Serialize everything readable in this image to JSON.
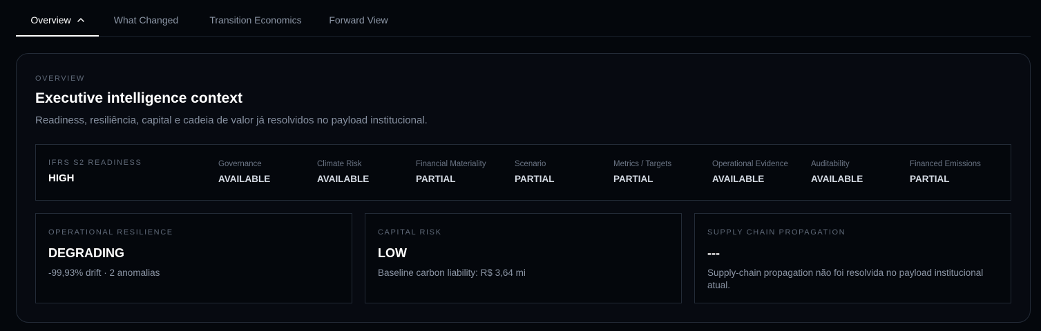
{
  "tabs": [
    {
      "label": "Overview",
      "active": true,
      "icon": "chevron-up-icon"
    },
    {
      "label": "What Changed",
      "active": false
    },
    {
      "label": "Transition Economics",
      "active": false
    },
    {
      "label": "Forward View",
      "active": false
    }
  ],
  "overview": {
    "eyebrow": "OVERVIEW",
    "title": "Executive intelligence context",
    "subtitle": "Readiness, resiliência, capital e cadeia de valor já resolvidos no payload institucional."
  },
  "readiness": {
    "label": "IFRS S2 READINESS",
    "value": "HIGH",
    "items": [
      {
        "label": "Governance",
        "value": "AVAILABLE"
      },
      {
        "label": "Climate Risk",
        "value": "AVAILABLE"
      },
      {
        "label": "Financial Materiality",
        "value": "PARTIAL"
      },
      {
        "label": "Scenario",
        "value": "PARTIAL"
      },
      {
        "label": "Metrics / Targets",
        "value": "PARTIAL"
      },
      {
        "label": "Operational Evidence",
        "value": "AVAILABLE"
      },
      {
        "label": "Auditability",
        "value": "AVAILABLE"
      },
      {
        "label": "Financed Emissions",
        "value": "PARTIAL"
      }
    ]
  },
  "cards": [
    {
      "label": "OPERATIONAL RESILIENCE",
      "value": "DEGRADING",
      "desc": "-99,93% drift · 2 anomalias"
    },
    {
      "label": "CAPITAL RISK",
      "value": "LOW",
      "desc": "Baseline carbon liability: R$ 3,64 mi"
    },
    {
      "label": "SUPPLY CHAIN PROPAGATION",
      "value": "---",
      "desc": "Supply-chain propagation não foi resolvida no payload institucional atual."
    }
  ],
  "colors": {
    "background": "#04070c",
    "panel": "#070a11",
    "border": "#232b37",
    "text_primary": "#ffffff",
    "text_muted": "#8c96a6",
    "label_muted": "#5f6978"
  }
}
